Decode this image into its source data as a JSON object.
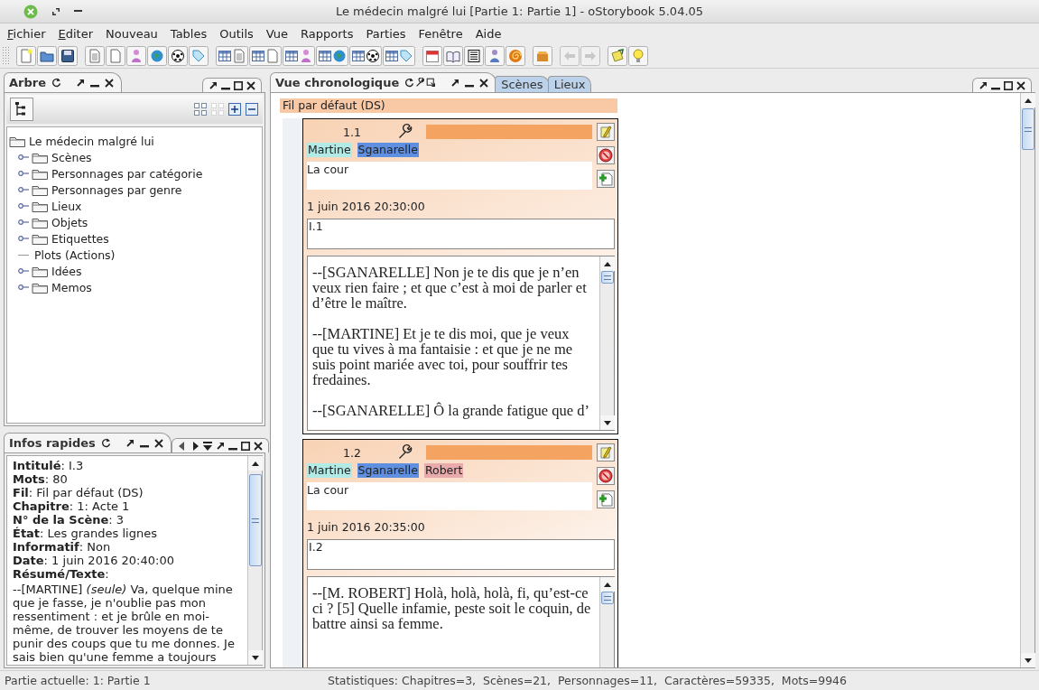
{
  "window": {
    "title": "Le médecin malgré lui [Partie 1: Partie 1] - oStorybook 5.04.05"
  },
  "menu": [
    {
      "label": "Fichier",
      "mnemonic": true
    },
    {
      "label": "Editer",
      "mnemonic": true
    },
    {
      "label": "Nouveau",
      "mnemonic": false
    },
    {
      "label": "Tables",
      "mnemonic": false
    },
    {
      "label": "Outils",
      "mnemonic": false
    },
    {
      "label": "Vue",
      "mnemonic": false
    },
    {
      "label": "Rapports",
      "mnemonic": false
    },
    {
      "label": "Parties",
      "mnemonic": false
    },
    {
      "label": "Fenêtre",
      "mnemonic": false
    },
    {
      "label": "Aide",
      "mnemonic": false
    }
  ],
  "toolbar": {
    "history_buttons": [
      {
        "disabled": true
      },
      {
        "disabled": true
      }
    ]
  },
  "tree_panel": {
    "tab": "Arbre",
    "root": {
      "label": "Le médecin malgré lui",
      "children": [
        {
          "label": "Scènes",
          "kind": "folder",
          "expanded": false
        },
        {
          "label": "Personnages par catégorie",
          "kind": "folder",
          "expanded": false
        },
        {
          "label": "Personnages par genre",
          "kind": "folder",
          "expanded": false
        },
        {
          "label": "Lieux",
          "kind": "folder",
          "expanded": false
        },
        {
          "label": "Objets",
          "kind": "folder",
          "expanded": false
        },
        {
          "label": "Etiquettes",
          "kind": "folder",
          "expanded": false
        },
        {
          "label": "Plots (Actions)",
          "kind": "leaf"
        },
        {
          "label": "Idées",
          "kind": "folder",
          "expanded": false
        },
        {
          "label": "Memos",
          "kind": "folder",
          "expanded": false
        }
      ]
    }
  },
  "info_panel": {
    "tab": "Infos rapides",
    "lines": [
      "**Intitulé**: I.3",
      "**Mots**: 80",
      "**Fil**: Fil par défaut (DS)",
      "**Chapitre**: 1: Acte 1",
      "**N° de la Scène**: 3",
      "**État**: Les grandes lignes",
      "**Informatif**: Non",
      "**Date**: 1 juin 2016 20:40:00",
      "**Résumé/Texte**:"
    ],
    "summary": "--[MARTINE] *(seule)* Va, quelque mine que je fasse, je n'oublie pas mon ressentiment : et je brûle en moi-même, de trouver les moyens de te punir des coups que tu me donnes. Je sais bien qu'une femme a toujours"
  },
  "chrono_panel": {
    "tabs": [
      {
        "label": "Vue chronologique",
        "selected": true
      },
      {
        "label": "Scènes",
        "selected": false
      },
      {
        "label": "Lieux",
        "selected": false
      }
    ],
    "strand": "Fil par défaut (DS)",
    "scenes": [
      {
        "number": "1.1",
        "characters": [
          {
            "name": "Martine",
            "color": "#b2ebe6"
          },
          {
            "name": "Sganarelle",
            "color": "#5e8fe0"
          }
        ],
        "location": "La cour",
        "date": "1 juin 2016 20:30:00",
        "title": "I.1",
        "text": [
          "--[SGANARELLE] Non je te dis que je n’en veux rien faire ; et que c’est à moi de parler et d’être le maître.",
          "--[MARTINE] Et je te dis moi, que je veux que tu vives à ma fantaisie : et que je ne me suis point mariée avec toi, pour souffrir tes fredaines.",
          "--[SGANARELLE] Ô la grande fatigue que d’"
        ]
      },
      {
        "number": "1.2",
        "characters": [
          {
            "name": "Martine",
            "color": "#b2ebe6"
          },
          {
            "name": "Sganarelle",
            "color": "#5e8fe0"
          },
          {
            "name": "Robert",
            "color": "#e8aaaa"
          }
        ],
        "location": "La cour",
        "date": "1 juin 2016 20:35:00",
        "title": "I.2",
        "text": [
          "--[M. ROBERT] Holà, holà, holà, fi, qu’est-ce ci ? [5] Quelle infamie, peste soit le coquin, de battre ainsi sa femme."
        ]
      }
    ]
  },
  "status_bar": {
    "part": "Partie actuelle: 1: Partie 1",
    "stats": "Statistiques: Chapitres=3,  Scènes=21,  Personnages=11,  Caractères=59335,  Mots=9946"
  }
}
